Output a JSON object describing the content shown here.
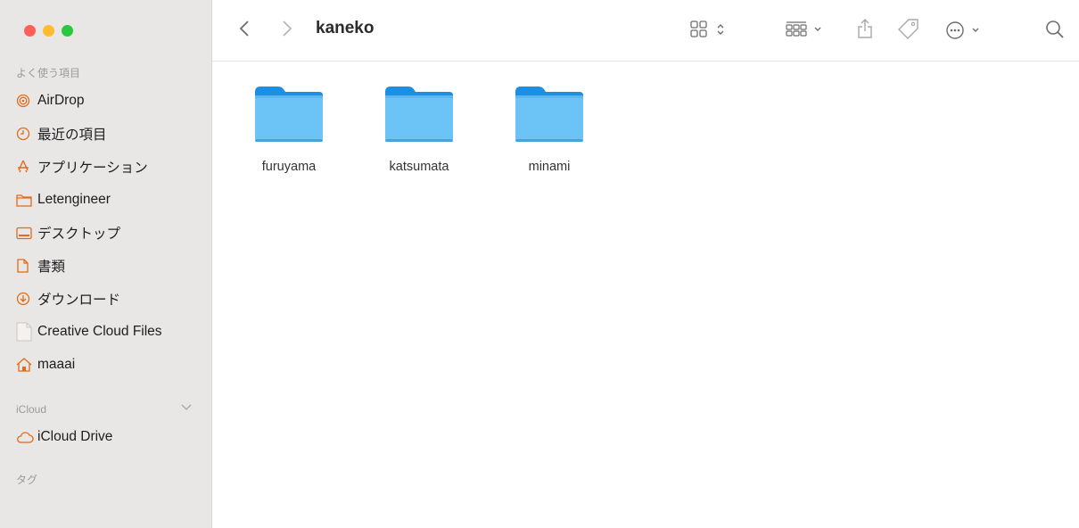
{
  "window": {
    "title": "kaneko"
  },
  "sidebar": {
    "favorites_label": "よく使う項目",
    "favorites": [
      {
        "label": "AirDrop",
        "icon": "airdrop-icon"
      },
      {
        "label": "最近の項目",
        "icon": "clock-icon"
      },
      {
        "label": "アプリケーション",
        "icon": "applications-icon"
      },
      {
        "label": "Letengineer",
        "icon": "folder-icon"
      },
      {
        "label": "デスクトップ",
        "icon": "desktop-icon"
      },
      {
        "label": "書類",
        "icon": "document-icon"
      },
      {
        "label": "ダウンロード",
        "icon": "download-icon"
      },
      {
        "label": "Creative Cloud Files",
        "icon": "file-icon"
      },
      {
        "label": "maaai",
        "icon": "home-icon"
      }
    ],
    "icloud_label": "iCloud",
    "icloud": [
      {
        "label": "iCloud Drive",
        "icon": "cloud-icon"
      }
    ],
    "tags_label": "タグ"
  },
  "toolbar": {
    "title": "kaneko"
  },
  "files": [
    {
      "name": "furuyama"
    },
    {
      "name": "katsumata"
    },
    {
      "name": "minami"
    }
  ],
  "colors": {
    "folder_top": "#1a8fe3",
    "folder_body": "#6cc4f6",
    "accent": "#2f7ad9"
  }
}
